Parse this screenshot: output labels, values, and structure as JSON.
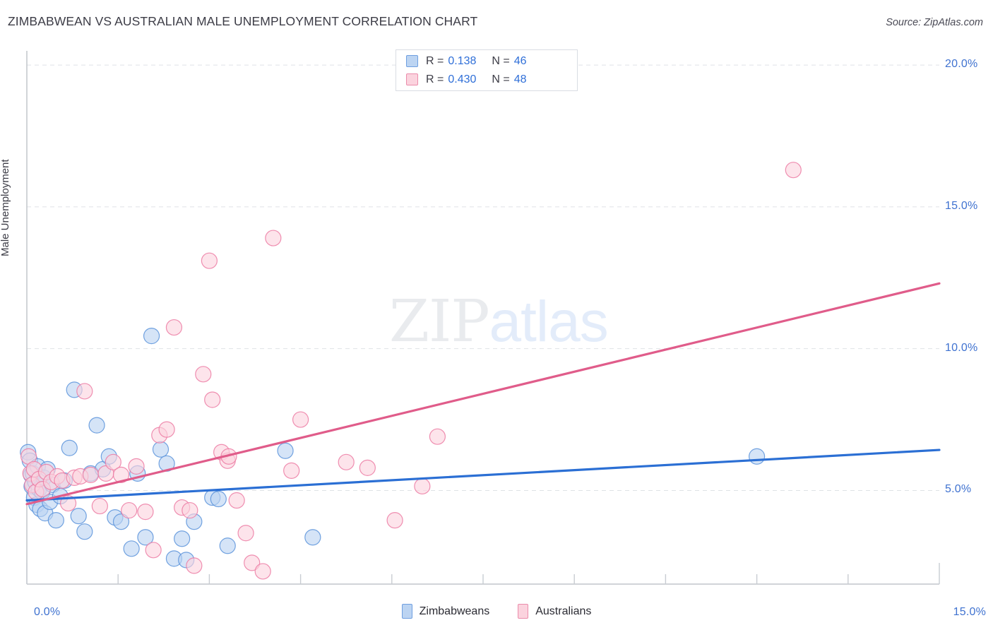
{
  "header": {
    "title": "ZIMBABWEAN VS AUSTRALIAN MALE UNEMPLOYMENT CORRELATION CHART",
    "source": "Source: ZipAtlas.com"
  },
  "watermark": {
    "part1": "ZIP",
    "part2": "atlas"
  },
  "stats": {
    "blue": {
      "r_label": "R =",
      "r_value": "0.138",
      "n_label": "N =",
      "n_value": "46"
    },
    "pink": {
      "r_label": "R =",
      "r_value": "0.430",
      "n_label": "N =",
      "n_value": "48"
    }
  },
  "legend": {
    "blue_label": "Zimbabweans",
    "pink_label": "Australians"
  },
  "chart_data": {
    "type": "scatter",
    "title": "ZIMBABWEAN VS AUSTRALIAN MALE UNEMPLOYMENT CORRELATION CHART",
    "xlabel": "",
    "ylabel": "Male Unemployment",
    "xlim": [
      0,
      15
    ],
    "ylim": [
      1.7,
      20.5
    ],
    "grid": true,
    "legend_position": "bottom-center",
    "x_ticks": [
      {
        "value": 0,
        "label": "0.0%"
      },
      {
        "value": 1.5,
        "label": ""
      },
      {
        "value": 3,
        "label": ""
      },
      {
        "value": 4.5,
        "label": ""
      },
      {
        "value": 6,
        "label": ""
      },
      {
        "value": 7.5,
        "label": ""
      },
      {
        "value": 9,
        "label": ""
      },
      {
        "value": 10.5,
        "label": ""
      },
      {
        "value": 12,
        "label": ""
      },
      {
        "value": 13.5,
        "label": ""
      },
      {
        "value": 15,
        "label": "15.0%"
      }
    ],
    "y_ticks": [
      {
        "value": 20,
        "label": "20.0%"
      },
      {
        "value": 15,
        "label": "15.0%"
      },
      {
        "value": 10,
        "label": "10.0%"
      },
      {
        "value": 5,
        "label": "5.0%"
      }
    ],
    "series": [
      {
        "name": "Zimbabweans",
        "color": "#bcd4f2",
        "edge": "#5b93da",
        "line_color": "#2b6fd4",
        "r": 0.138,
        "n": 46,
        "trend": {
          "x0": 0,
          "y0": 4.65,
          "x1": 15,
          "y1": 6.43
        },
        "points": [
          [
            0.02,
            6.35
          ],
          [
            0.05,
            6.05
          ],
          [
            0.07,
            5.55
          ],
          [
            0.08,
            5.15
          ],
          [
            0.1,
            5.6
          ],
          [
            0.12,
            4.75
          ],
          [
            0.14,
            5.3
          ],
          [
            0.16,
            4.5
          ],
          [
            0.18,
            5.85
          ],
          [
            0.2,
            5.05
          ],
          [
            0.22,
            4.35
          ],
          [
            0.25,
            4.95
          ],
          [
            0.28,
            5.45
          ],
          [
            0.3,
            4.2
          ],
          [
            0.34,
            5.75
          ],
          [
            0.38,
            4.6
          ],
          [
            0.42,
            5.2
          ],
          [
            0.48,
            3.95
          ],
          [
            0.55,
            4.8
          ],
          [
            0.62,
            5.35
          ],
          [
            0.7,
            6.5
          ],
          [
            0.78,
            8.55
          ],
          [
            0.85,
            4.1
          ],
          [
            0.95,
            3.55
          ],
          [
            1.05,
            5.6
          ],
          [
            1.15,
            7.3
          ],
          [
            1.25,
            5.75
          ],
          [
            1.35,
            6.2
          ],
          [
            1.45,
            4.05
          ],
          [
            1.55,
            3.9
          ],
          [
            1.72,
            2.95
          ],
          [
            1.82,
            5.6
          ],
          [
            1.95,
            3.35
          ],
          [
            2.05,
            10.45
          ],
          [
            2.2,
            6.45
          ],
          [
            2.3,
            5.95
          ],
          [
            2.42,
            2.6
          ],
          [
            2.55,
            3.3
          ],
          [
            2.62,
            2.55
          ],
          [
            2.75,
            3.9
          ],
          [
            3.05,
            4.75
          ],
          [
            3.15,
            4.7
          ],
          [
            3.3,
            3.05
          ],
          [
            4.25,
            6.4
          ],
          [
            4.7,
            3.35
          ],
          [
            12.0,
            6.2
          ]
        ]
      },
      {
        "name": "Australians",
        "color": "#fbd3de",
        "edge": "#ec7ba3",
        "line_color": "#e05c8a",
        "r": 0.43,
        "n": 48,
        "trend": {
          "x0": 0,
          "y0": 4.52,
          "x1": 15,
          "y1": 12.3
        },
        "points": [
          [
            0.03,
            6.2
          ],
          [
            0.06,
            5.6
          ],
          [
            0.09,
            5.2
          ],
          [
            0.12,
            5.75
          ],
          [
            0.15,
            4.95
          ],
          [
            0.2,
            5.4
          ],
          [
            0.26,
            5.05
          ],
          [
            0.32,
            5.65
          ],
          [
            0.4,
            5.3
          ],
          [
            0.5,
            5.5
          ],
          [
            0.58,
            5.35
          ],
          [
            0.68,
            4.55
          ],
          [
            0.78,
            5.45
          ],
          [
            0.88,
            5.5
          ],
          [
            0.95,
            8.5
          ],
          [
            1.05,
            5.55
          ],
          [
            1.2,
            4.45
          ],
          [
            1.3,
            5.6
          ],
          [
            1.42,
            6.0
          ],
          [
            1.55,
            5.55
          ],
          [
            1.68,
            4.3
          ],
          [
            1.8,
            5.85
          ],
          [
            1.95,
            4.25
          ],
          [
            2.08,
            2.9
          ],
          [
            2.18,
            6.95
          ],
          [
            2.3,
            7.15
          ],
          [
            2.42,
            10.75
          ],
          [
            2.55,
            4.4
          ],
          [
            2.68,
            4.3
          ],
          [
            2.75,
            2.35
          ],
          [
            2.9,
            9.1
          ],
          [
            3.0,
            13.1
          ],
          [
            3.05,
            8.2
          ],
          [
            3.2,
            6.35
          ],
          [
            3.3,
            6.05
          ],
          [
            3.32,
            6.2
          ],
          [
            3.45,
            4.65
          ],
          [
            3.6,
            3.5
          ],
          [
            3.7,
            2.45
          ],
          [
            3.88,
            2.15
          ],
          [
            4.05,
            13.9
          ],
          [
            4.35,
            5.7
          ],
          [
            4.5,
            7.5
          ],
          [
            5.25,
            6.0
          ],
          [
            5.6,
            5.8
          ],
          [
            6.05,
            3.95
          ],
          [
            6.5,
            5.15
          ],
          [
            6.75,
            6.9
          ],
          [
            12.6,
            16.3
          ]
        ]
      }
    ]
  }
}
